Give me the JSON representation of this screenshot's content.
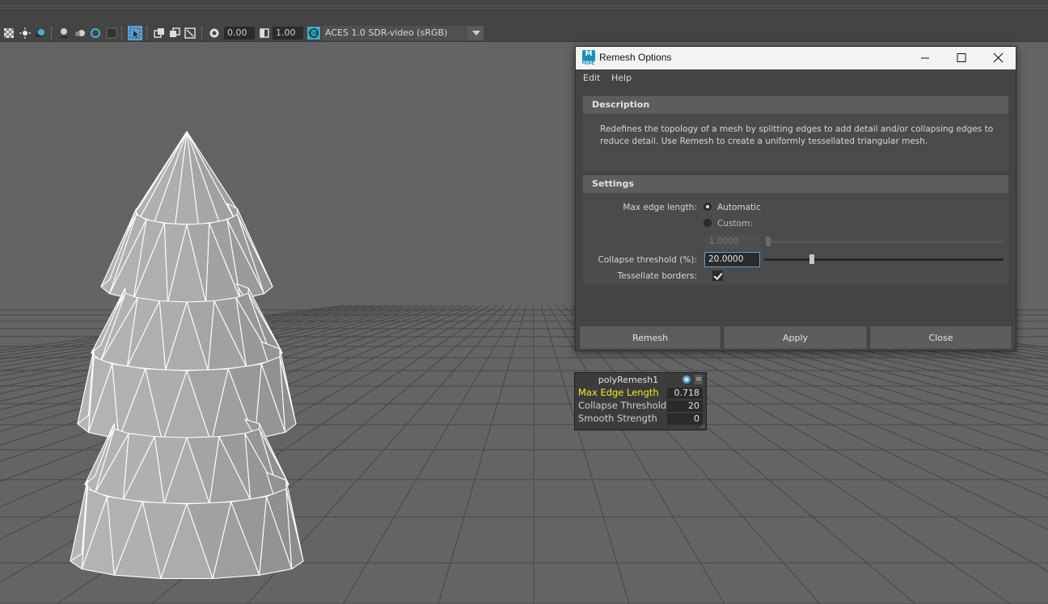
{
  "toolbar": {
    "exposure_value": "0.00",
    "gamma_value": "1.00",
    "colorspace_value": "ACES 1.0 SDR-video (sRGB)",
    "icons": [
      "checker-icon",
      "light-icon",
      "shadow-icon",
      "ambient-occlusion-icon",
      "motion-blur-icon",
      "anti-aliasing-icon",
      "depth-of-field-icon",
      "isolate-select-icon",
      "xray-icon",
      "xray-joints-icon",
      "xray-active-icon",
      "backface-icon",
      "exposure-icon",
      "gamma-icon",
      "color-management-icon"
    ],
    "accent_color": "#5d9fd0"
  },
  "dialog": {
    "title": "Remesh Options",
    "menu": [
      "Edit",
      "Help"
    ],
    "description_header": "Description",
    "description_text": "Redefines the topology of a mesh by splitting edges to add detail and/or collapsing edges to reduce detail. Use Remesh to create a uniformly tessellated triangular mesh.",
    "settings_header": "Settings",
    "max_edge_label": "Max edge length:",
    "option_automatic": "Automatic",
    "option_custom": "Custom:",
    "selected_option": "Automatic",
    "custom_value": "1.0000",
    "collapse_label": "Collapse threshold (%):",
    "collapse_value": "20.0000",
    "collapse_slider_fraction": 0.2,
    "tessellate_label": "Tessellate borders:",
    "tessellate_checked": true,
    "buttons": {
      "remesh": "Remesh",
      "apply": "Apply",
      "close": "Close"
    }
  },
  "hud": {
    "title": "polyRemesh1",
    "rows": [
      {
        "name": "Max Edge Length",
        "value": "0.718",
        "highlight": true
      },
      {
        "name": "Collapse  Threshold",
        "value": "20",
        "highlight": false
      },
      {
        "name": "Smooth  Strength",
        "value": "0",
        "highlight": false
      }
    ]
  },
  "viewport": {
    "object": "tree-mesh",
    "grid": true,
    "background_color": "#646464",
    "grid_color": "#3f3f3f"
  }
}
